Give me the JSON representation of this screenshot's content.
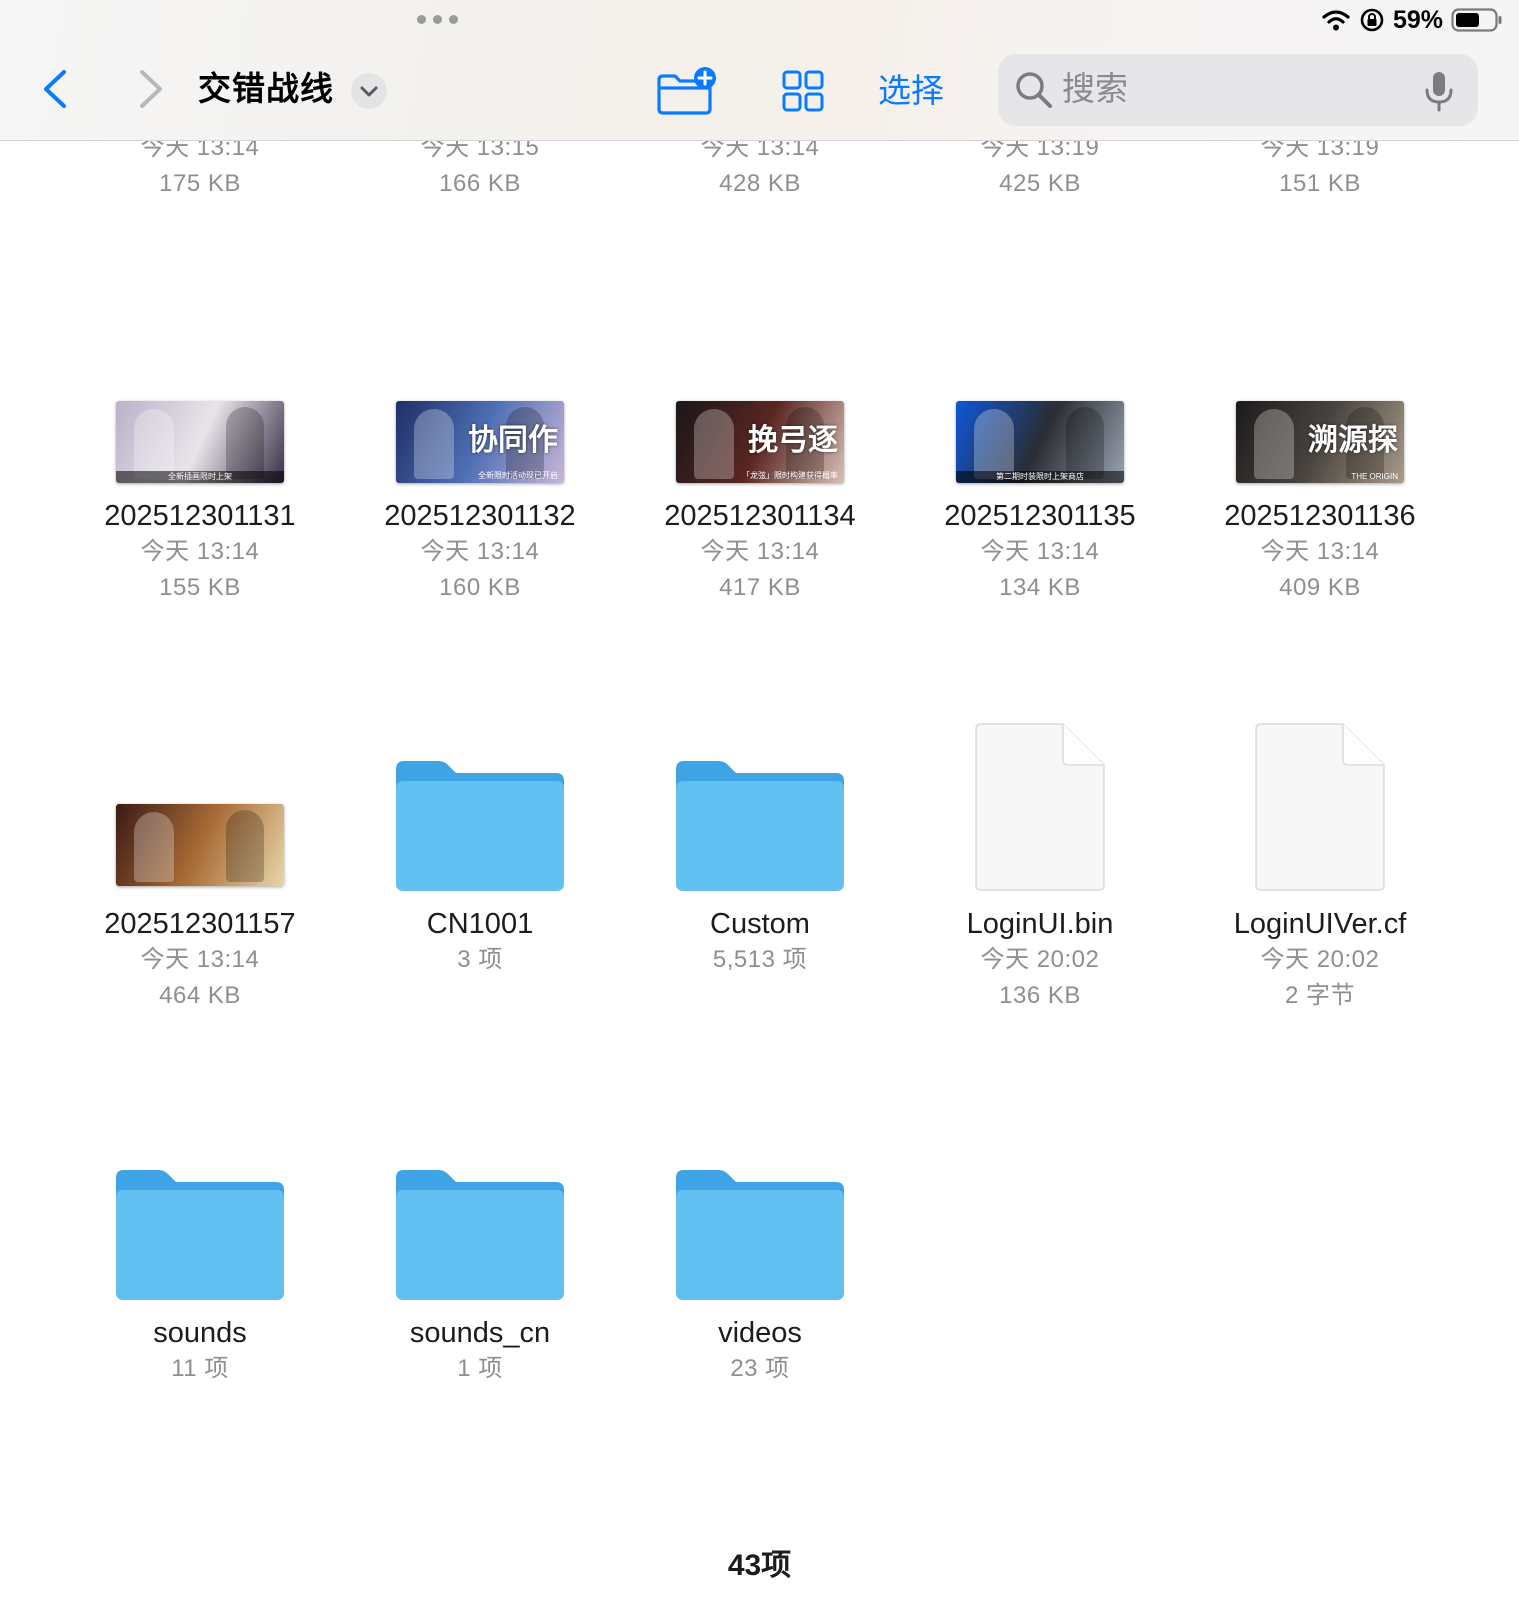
{
  "status": {
    "battery_percent": "59%"
  },
  "toolbar": {
    "title": "交错战线",
    "select_label": "选择"
  },
  "search": {
    "placeholder": "搜索"
  },
  "partial_row": [
    {
      "meta1": "今天 13:14",
      "meta2": "175 KB"
    },
    {
      "meta1": "今天 13:15",
      "meta2": "166 KB"
    },
    {
      "meta1": "今天 13:14",
      "meta2": "428 KB"
    },
    {
      "meta1": "今天 13:19",
      "meta2": "425 KB"
    },
    {
      "meta1": "今天 13:19",
      "meta2": "151 KB"
    }
  ],
  "row2": [
    {
      "name": "202512301131",
      "meta1": "今天 13:14",
      "meta2": "155 KB",
      "thumb_text": "全新插画限时上架",
      "colors": [
        "#b9b2c9",
        "#e9e4ea",
        "#3a2f48"
      ]
    },
    {
      "name": "202512301132",
      "meta1": "今天 13:14",
      "meta2": "160 KB",
      "thumb_text": "协同作",
      "thumb_sub": "全新限时活动现已开启",
      "colors": [
        "#1e2f66",
        "#4f6fb5",
        "#c9b6d8"
      ]
    },
    {
      "name": "202512301134",
      "meta1": "今天 13:14",
      "meta2": "417 KB",
      "thumb_text": "挽弓逐",
      "thumb_sub": "「龙弦」限时构建获得概率",
      "colors": [
        "#1a1618",
        "#5a2622",
        "#d7c1b6"
      ]
    },
    {
      "name": "202512301135",
      "meta1": "今天 13:14",
      "meta2": "134 KB",
      "thumb_text": "第二期时装限时上架商店",
      "colors": [
        "#0f57d8",
        "#2a2d34",
        "#9aa4b2"
      ]
    },
    {
      "name": "202512301136",
      "meta1": "今天 13:14",
      "meta2": "409 KB",
      "thumb_text": "溯源探",
      "thumb_sub": "THE ORIGIN",
      "colors": [
        "#1c1a1a",
        "#4a4440",
        "#a89b8a"
      ]
    }
  ],
  "row3": [
    {
      "name": "202512301157",
      "meta1": "今天 13:14",
      "meta2": "464 KB",
      "type": "image",
      "colors": [
        "#3a1a14",
        "#a86a36",
        "#e8d6a8"
      ]
    },
    {
      "name": "CN1001",
      "meta1": "3 项",
      "type": "folder"
    },
    {
      "name": "Custom",
      "meta1": "5,513 项",
      "type": "folder"
    },
    {
      "name": "LoginUI.bin",
      "meta1": "今天 20:02",
      "meta2": "136 KB",
      "type": "doc"
    },
    {
      "name": "LoginUIVer.cf",
      "meta1": "今天 20:02",
      "meta2": "2 字节",
      "type": "doc"
    }
  ],
  "row4": [
    {
      "name": "sounds",
      "meta1": "11 项",
      "type": "folder"
    },
    {
      "name": "sounds_cn",
      "meta1": "1 项",
      "type": "folder"
    },
    {
      "name": "videos",
      "meta1": "23 项",
      "type": "folder"
    }
  ],
  "footer": {
    "count": "43项"
  },
  "colors": {
    "accent": "#0a7bff",
    "folder_front": "#62c0f2",
    "folder_back": "#3ea4e6"
  }
}
